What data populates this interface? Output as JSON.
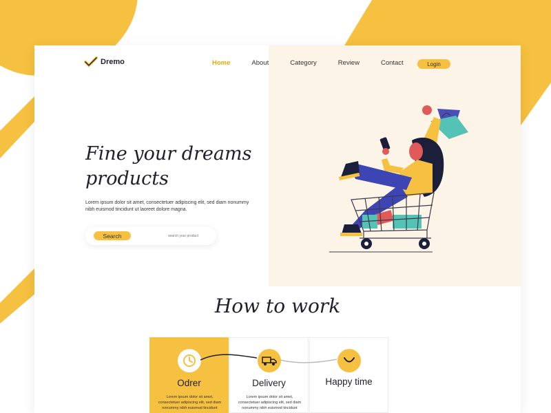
{
  "brand": {
    "name": "Dremo",
    "accent": "#F6C040",
    "accent_dark": "#E8A90E",
    "icon": "checkmark-icon"
  },
  "nav": {
    "items": [
      {
        "label": "Home",
        "active": true
      },
      {
        "label": "About",
        "active": false
      },
      {
        "label": "Category",
        "active": false
      },
      {
        "label": "Review",
        "active": false
      },
      {
        "label": "Contact",
        "active": false
      }
    ],
    "login_label": "Login"
  },
  "hero": {
    "title_line1": "Fine your dreams",
    "title_line2": "products",
    "description": "Lorem ipsum dolor sit amet, consectetuer adipiscing elit, sed diam nonummy nibh euismod tincidunt ut laoreet dolore magna.",
    "search_button": "Search",
    "search_placeholder": "search your product"
  },
  "how_to_work": {
    "title": "How to work",
    "steps": [
      {
        "title": "Odrer",
        "icon": "order-clock-icon",
        "text": "Lorem ipsum dolor sit amet, consectetuer adipiscing elit, sed diam nonummy nibh euismod tincidunt"
      },
      {
        "title": "Delivery",
        "icon": "delivery-truck-icon",
        "text": "Lorem ipsum dolor sit amet, consectetuer adipiscing elit, sed diam nonummy nibh euismod tincidunt"
      },
      {
        "title": "Happy time",
        "icon": "smile-icon",
        "text": ""
      }
    ]
  }
}
